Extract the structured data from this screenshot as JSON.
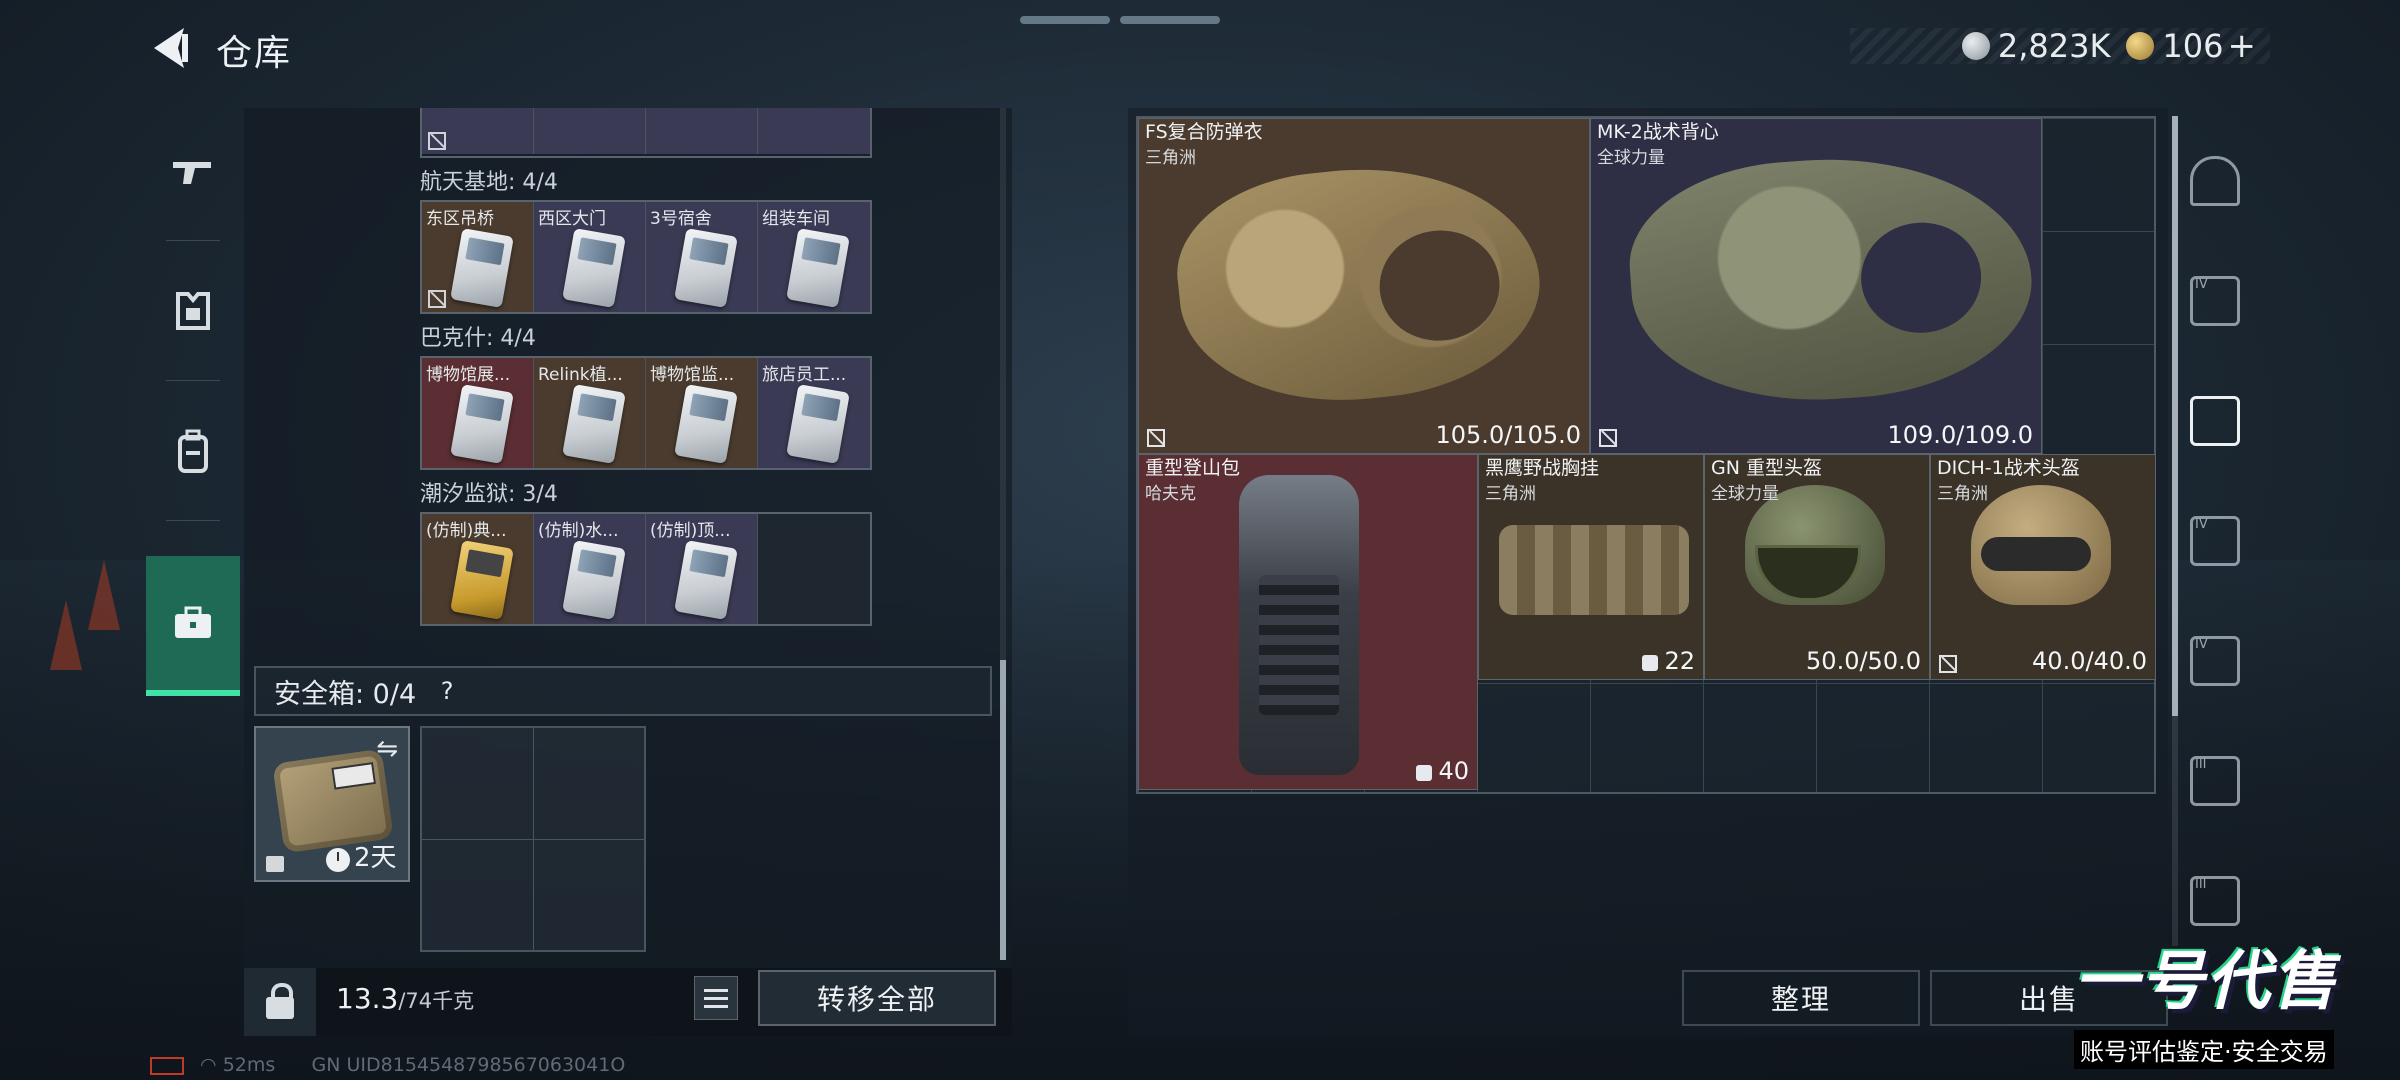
{
  "header": {
    "title": "仓库",
    "silver_amount": "2,823K",
    "gold_amount": "106",
    "plus_label": "+"
  },
  "left_nav": {
    "items": [
      {
        "icon": "gun-icon"
      },
      {
        "icon": "armor-icon"
      },
      {
        "icon": "backpack-icon"
      },
      {
        "icon": "briefcase-icon",
        "active": true
      }
    ]
  },
  "warehouse": {
    "groups": [
      {
        "label": "航天基地: 4/4",
        "items": [
          {
            "name": "东区吊桥",
            "color": "brown",
            "flag": true
          },
          {
            "name": "西区大门",
            "color": "purple"
          },
          {
            "name": "3号宿舍",
            "color": "purple"
          },
          {
            "name": "组装车间",
            "color": "purple"
          }
        ]
      },
      {
        "label": "巴克什: 4/4",
        "items": [
          {
            "name": "博物馆展...",
            "color": "red"
          },
          {
            "name": "Relink植...",
            "color": "brown"
          },
          {
            "name": "博物馆监...",
            "color": "brown"
          },
          {
            "name": "旅店员工...",
            "color": "purple"
          }
        ]
      },
      {
        "label": "潮汐监狱: 3/4",
        "items": [
          {
            "name": "(仿制)典...",
            "color": "brown",
            "gold": true
          },
          {
            "name": "(仿制)水...",
            "color": "purple"
          },
          {
            "name": "(仿制)顶...",
            "color": "purple"
          },
          {
            "name": "",
            "color": "empty"
          }
        ]
      }
    ],
    "safebox": {
      "label": "安全箱: 0/4",
      "help": "?",
      "days": "2天",
      "swap": "⇋"
    },
    "weight": "13.3",
    "weight_unit": "/74千克",
    "transfer_all": "转移全部"
  },
  "equipment": {
    "items": [
      {
        "name": "FS复合防弹衣",
        "maker": "三角洲",
        "value": "105.0/105.0"
      },
      {
        "name": "MK-2战术背心",
        "maker": "全球力量",
        "value": "109.0/109.0"
      },
      {
        "name": "重型登山包",
        "maker": "哈夫克",
        "value": "40"
      },
      {
        "name": "黑鹰野战胸挂",
        "maker": "三角洲",
        "value": "22"
      },
      {
        "name": "GN 重型头盔",
        "maker": "全球力量",
        "value": "50.0/50.0"
      },
      {
        "name": "DICH-1战术头盔",
        "maker": "三角洲",
        "value": "40.0/40.0"
      }
    ],
    "sort_label": "整理",
    "sell_label": "出售"
  },
  "watermark": {
    "title": "一号代售",
    "subtitle": "账号评估鉴定·安全交易"
  },
  "status": {
    "ping": "52ms",
    "uid": "GN UID8154548798567063041O"
  },
  "colors": {
    "accent_green": "#3fe3a8",
    "item_brown": "#4a3b2e",
    "item_purple": "#3a3a55",
    "item_red": "#5a2e32"
  }
}
